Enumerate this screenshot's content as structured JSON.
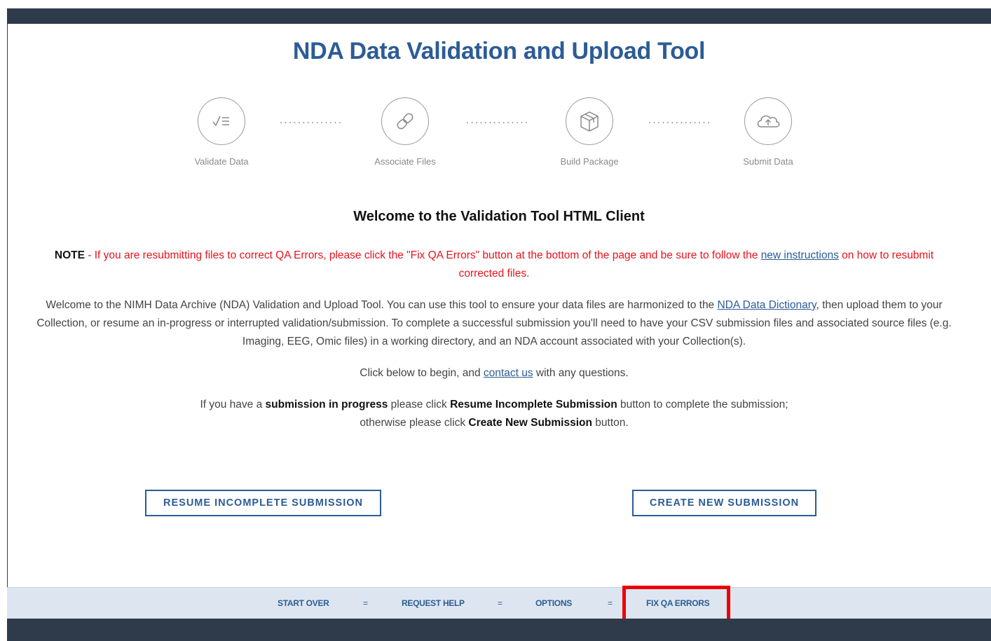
{
  "header": {
    "title": "NDA Data Validation and Upload Tool"
  },
  "steps": [
    {
      "label": "Validate Data",
      "icon": "checklist-icon"
    },
    {
      "label": "Associate Files",
      "icon": "link-icon"
    },
    {
      "label": "Build Package",
      "icon": "box-icon"
    },
    {
      "label": "Submit Data",
      "icon": "cloud-upload-icon"
    }
  ],
  "step_connector": "..............",
  "welcome_heading": "Welcome to the Validation Tool HTML Client",
  "note": {
    "label": "NOTE",
    "text_before": " - If you are resubmitting files to correct QA Errors, please click the \"Fix QA Errors\" button at the bottom of the page and be sure to follow the ",
    "link": "new instructions",
    "text_after": " on how to resubmit corrected files."
  },
  "intro": {
    "text_before": "Welcome to the NIMH Data Archive (NDA) Validation and Upload Tool. You can use this tool to ensure your data  files are harmonized to the ",
    "link": "NDA Data Dictionary",
    "text_after": ", then upload them to your Collection, or resume an in-progress or interrupted validation/submission. To complete a successful submission you'll need to have your CSV submission files and associated source files (e.g. Imaging, EEG, Omic files) in a working directory, and an NDA account associated with your Collection(s)."
  },
  "contact": {
    "text_before": "Click below to begin, and ",
    "link": "contact us",
    "text_after": " with any questions."
  },
  "instructions": {
    "p1": "If you have a ",
    "b1": "submission in progress",
    "p2": " please click ",
    "b2": "Resume Incomplete Submission",
    "p3": "  button to complete the submission;",
    "p4": "otherwise please click ",
    "b3": "Create New Submission",
    "p5": " button."
  },
  "buttons": {
    "resume": "RESUME INCOMPLETE SUBMISSION",
    "create": "CREATE NEW SUBMISSION"
  },
  "bottom_nav": {
    "start_over": "START OVER",
    "request_help": "REQUEST HELP",
    "options": "OPTIONS",
    "fix_qa": "FIX QA ERRORS",
    "separator": "="
  },
  "colors": {
    "accent": "#2c5c95",
    "note_red": "#e8131b",
    "dark_bar": "#2f3b4a",
    "nav_bg": "#dde6f0",
    "highlight": "#ee0000"
  }
}
